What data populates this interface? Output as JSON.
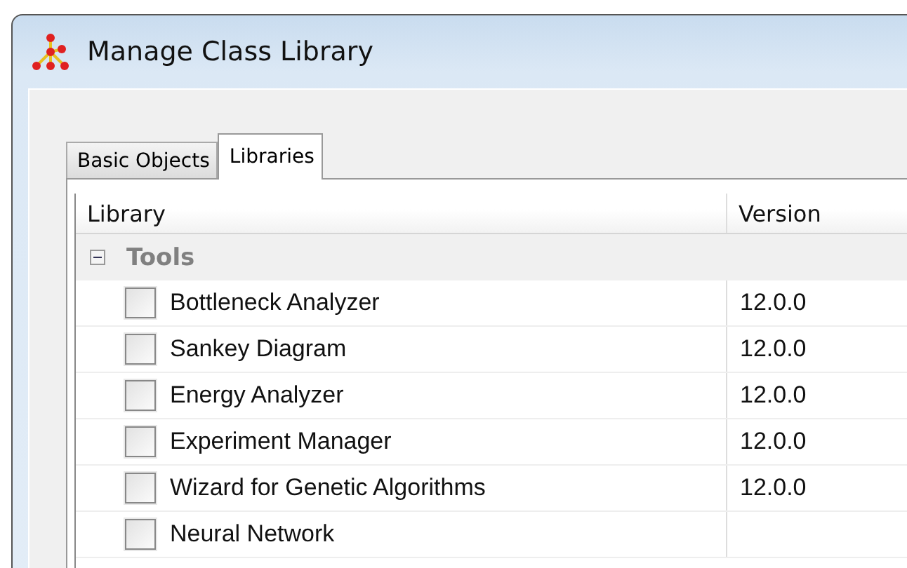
{
  "window": {
    "title": "Manage Class Library"
  },
  "tabs": [
    {
      "label": "Basic Objects",
      "selected": false
    },
    {
      "label": "Libraries",
      "selected": true
    }
  ],
  "table": {
    "columns": [
      "Library",
      "Version"
    ],
    "groups": [
      {
        "name": "Tools",
        "expanded": true,
        "rows": [
          {
            "name": "Bottleneck Analyzer",
            "version": "12.0.0",
            "checked": false
          },
          {
            "name": "Sankey Diagram",
            "version": "12.0.0",
            "checked": false
          },
          {
            "name": "Energy Analyzer",
            "version": "12.0.0",
            "checked": false
          },
          {
            "name": "Experiment Manager",
            "version": "12.0.0",
            "checked": false
          },
          {
            "name": "Wizard for Genetic Algorithms",
            "version": "12.0.0",
            "checked": false
          },
          {
            "name": "Neural Network",
            "checked": false
          }
        ]
      }
    ]
  }
}
